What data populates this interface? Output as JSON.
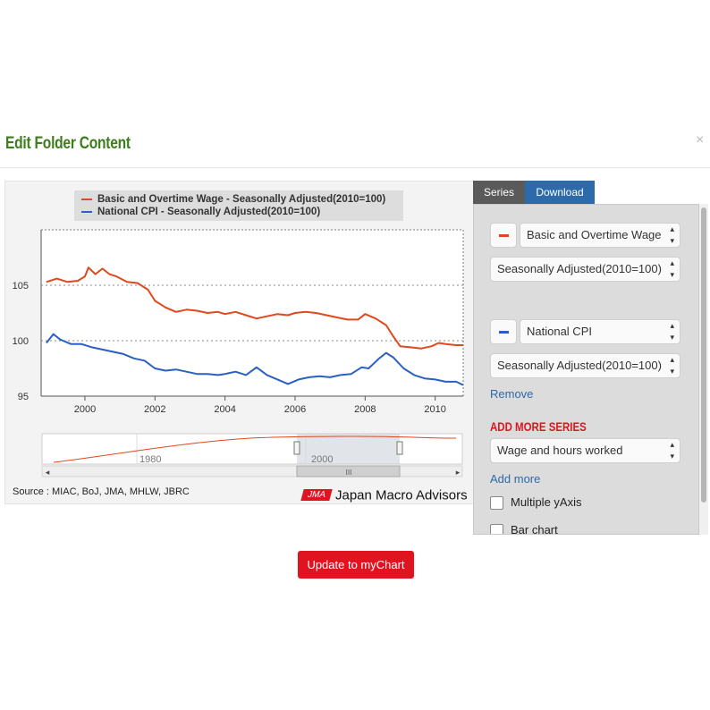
{
  "modal": {
    "title": "Edit Folder Content",
    "close_label": "×"
  },
  "legend": {
    "items": [
      {
        "label": "Basic and Overtime Wage - Seasonally Adjusted(2010=100)",
        "color": "#e0481e"
      },
      {
        "label": "National CPI - Seasonally Adjusted(2010=100)",
        "color": "#2a60c4"
      }
    ]
  },
  "chart_data": {
    "type": "line",
    "x_ticks": [
      "2000",
      "2002",
      "2004",
      "2006",
      "2008",
      "2010"
    ],
    "y_ticks": [
      "95",
      "100",
      "105"
    ],
    "ylim": [
      95,
      110
    ],
    "grid": "dotted horizontal at 100 and 105",
    "series": [
      {
        "name": "Basic and Overtime Wage - Seasonally Adjusted(2010=100)",
        "color": "#e0481e",
        "points": [
          [
            1998.9,
            105.3
          ],
          [
            1999.2,
            105.6
          ],
          [
            1999.5,
            105.3
          ],
          [
            1999.8,
            105.4
          ],
          [
            2000.0,
            105.8
          ],
          [
            2000.1,
            106.6
          ],
          [
            2000.3,
            106.0
          ],
          [
            2000.5,
            106.5
          ],
          [
            2000.7,
            106.0
          ],
          [
            2000.9,
            105.8
          ],
          [
            2001.2,
            105.3
          ],
          [
            2001.5,
            105.2
          ],
          [
            2001.8,
            104.6
          ],
          [
            2002.0,
            103.6
          ],
          [
            2002.3,
            103.0
          ],
          [
            2002.6,
            102.6
          ],
          [
            2002.9,
            102.8
          ],
          [
            2003.2,
            102.7
          ],
          [
            2003.5,
            102.5
          ],
          [
            2003.8,
            102.6
          ],
          [
            2004.0,
            102.4
          ],
          [
            2004.3,
            102.6
          ],
          [
            2004.6,
            102.3
          ],
          [
            2004.9,
            102.0
          ],
          [
            2005.2,
            102.2
          ],
          [
            2005.5,
            102.4
          ],
          [
            2005.8,
            102.3
          ],
          [
            2006.0,
            102.5
          ],
          [
            2006.3,
            102.6
          ],
          [
            2006.6,
            102.5
          ],
          [
            2006.9,
            102.3
          ],
          [
            2007.2,
            102.1
          ],
          [
            2007.5,
            101.9
          ],
          [
            2007.8,
            101.9
          ],
          [
            2008.0,
            102.4
          ],
          [
            2008.3,
            102.0
          ],
          [
            2008.6,
            101.4
          ],
          [
            2008.8,
            100.4
          ],
          [
            2009.0,
            99.5
          ],
          [
            2009.3,
            99.4
          ],
          [
            2009.6,
            99.3
          ],
          [
            2009.9,
            99.5
          ],
          [
            2010.1,
            99.8
          ],
          [
            2010.3,
            99.7
          ],
          [
            2010.6,
            99.6
          ],
          [
            2010.8,
            99.6
          ]
        ]
      },
      {
        "name": "National CPI - Seasonally Adjusted(2010=100)",
        "color": "#2a60c4",
        "points": [
          [
            1998.9,
            99.8
          ],
          [
            1999.1,
            100.6
          ],
          [
            1999.3,
            100.1
          ],
          [
            1999.6,
            99.7
          ],
          [
            1999.9,
            99.7
          ],
          [
            2000.2,
            99.4
          ],
          [
            2000.5,
            99.2
          ],
          [
            2000.8,
            99.0
          ],
          [
            2001.1,
            98.8
          ],
          [
            2001.4,
            98.4
          ],
          [
            2001.7,
            98.2
          ],
          [
            2002.0,
            97.5
          ],
          [
            2002.3,
            97.3
          ],
          [
            2002.6,
            97.4
          ],
          [
            2002.9,
            97.2
          ],
          [
            2003.2,
            97.0
          ],
          [
            2003.5,
            97.0
          ],
          [
            2003.8,
            96.9
          ],
          [
            2004.0,
            97.0
          ],
          [
            2004.3,
            97.2
          ],
          [
            2004.6,
            96.9
          ],
          [
            2004.9,
            97.6
          ],
          [
            2005.2,
            96.9
          ],
          [
            2005.5,
            96.5
          ],
          [
            2005.8,
            96.1
          ],
          [
            2006.1,
            96.5
          ],
          [
            2006.4,
            96.7
          ],
          [
            2006.7,
            96.8
          ],
          [
            2007.0,
            96.7
          ],
          [
            2007.3,
            96.9
          ],
          [
            2007.6,
            97.0
          ],
          [
            2007.9,
            97.6
          ],
          [
            2008.1,
            97.5
          ],
          [
            2008.4,
            98.4
          ],
          [
            2008.6,
            98.9
          ],
          [
            2008.8,
            98.5
          ],
          [
            2009.1,
            97.5
          ],
          [
            2009.4,
            96.9
          ],
          [
            2009.7,
            96.6
          ],
          [
            2010.0,
            96.5
          ],
          [
            2010.3,
            96.3
          ],
          [
            2010.6,
            96.3
          ],
          [
            2010.8,
            96.0
          ]
        ]
      }
    ]
  },
  "navigator": {
    "labels": [
      "1980",
      "2000"
    ],
    "scroll_grip": "III",
    "left_arrow": "◂",
    "right_arrow": "▸"
  },
  "source": "Source : MIAC, BoJ, JMA, MHLW, JBRC",
  "brand": {
    "badge": "JMA",
    "name": "Japan Macro Advisors"
  },
  "panel": {
    "tabs": [
      "Series",
      "Download"
    ],
    "series": [
      {
        "color": "#e0481e",
        "name": "Basic and Overtime Wage",
        "adjustment": "Seasonally Adjusted(2010=100)"
      },
      {
        "color": "#2a60c4",
        "name": "National CPI",
        "adjustment": "Seasonally Adjusted(2010=100)"
      }
    ],
    "remove_label": "Remove",
    "add_more_title": "ADD MORE SERIES",
    "add_select": "Wage and hours worked",
    "add_more_link": "Add more",
    "checkboxes": [
      "Multiple yAxis",
      "Bar chart"
    ]
  },
  "update_button": "Update to myChart"
}
